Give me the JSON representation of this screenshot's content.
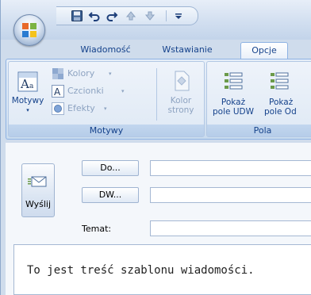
{
  "quick_access": {
    "icons": [
      "save-icon",
      "undo-icon",
      "redo-icon",
      "up-arrow-icon",
      "down-arrow-icon",
      "customize-dropdown-icon"
    ]
  },
  "tabs": [
    {
      "label": "Wiadomość",
      "active": false
    },
    {
      "label": "Wstawianie",
      "active": false
    },
    {
      "label": "Opcje",
      "active": true
    }
  ],
  "ribbon": {
    "motywy_group": {
      "label": "Motywy",
      "motywy_button": "Motywy",
      "kolory": "Kolory",
      "czcionki": "Czcionki",
      "efekty": "Efekty",
      "kolor_strony_line1": "Kolor",
      "kolor_strony_line2": "strony"
    },
    "pola_group": {
      "label": "Pola",
      "show_bcc_line1": "Pokaż",
      "show_bcc_line2": "pole UDW",
      "show_from_line1": "Pokaż",
      "show_from_line2": "pole Od"
    }
  },
  "message": {
    "send_label": "Wyślij",
    "to_button": "Do...",
    "cc_button": "DW...",
    "subject_label": "Temat:",
    "to_value": "",
    "cc_value": "",
    "subject_value": "",
    "body_text": "To jest treść szablonu wiadomości."
  },
  "colors": {
    "ribbon_text": "#15428b",
    "ribbon_bg": "#d7e4f3",
    "window_bg": "#cfdcec"
  }
}
